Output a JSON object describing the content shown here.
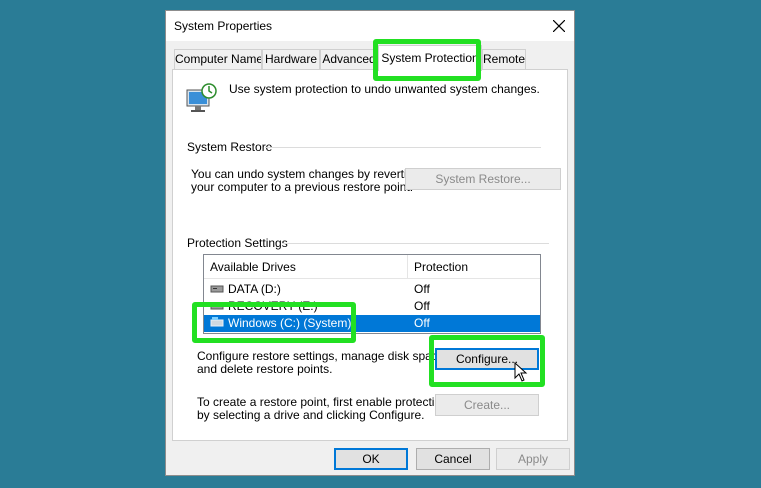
{
  "window": {
    "title": "System Properties"
  },
  "tabs": [
    {
      "label": "Computer Name"
    },
    {
      "label": "Hardware"
    },
    {
      "label": "Advanced"
    },
    {
      "label": "System Protection"
    },
    {
      "label": "Remote"
    }
  ],
  "header": {
    "description": "Use system protection to undo unwanted system changes."
  },
  "system_restore": {
    "group_label": "System Restore",
    "text_line1": "You can undo system changes by reverting",
    "text_line2": "your computer to a previous restore point.",
    "button_label": "System Restore..."
  },
  "protection_settings": {
    "group_label": "Protection Settings",
    "columns": [
      "Available Drives",
      "Protection"
    ],
    "drives": [
      {
        "name": "DATA (D:)",
        "protection": "Off"
      },
      {
        "name": "RECOVERY (E:)",
        "protection": "Off"
      },
      {
        "name": "Windows (C:) (System)",
        "protection": "Off"
      }
    ],
    "configure_text_line1": "Configure restore settings, manage disk space,",
    "configure_text_line2": "and delete restore points.",
    "configure_button": "Configure...",
    "create_text_line1": "To create a restore point, first enable protection",
    "create_text_line2": "by selecting a drive and clicking Configure.",
    "create_button": "Create..."
  },
  "footer": {
    "ok": "OK",
    "cancel": "Cancel",
    "apply": "Apply"
  },
  "colors": {
    "desktop": "#2a7c96",
    "selection": "#0078d7",
    "highlight": "#22e022"
  }
}
